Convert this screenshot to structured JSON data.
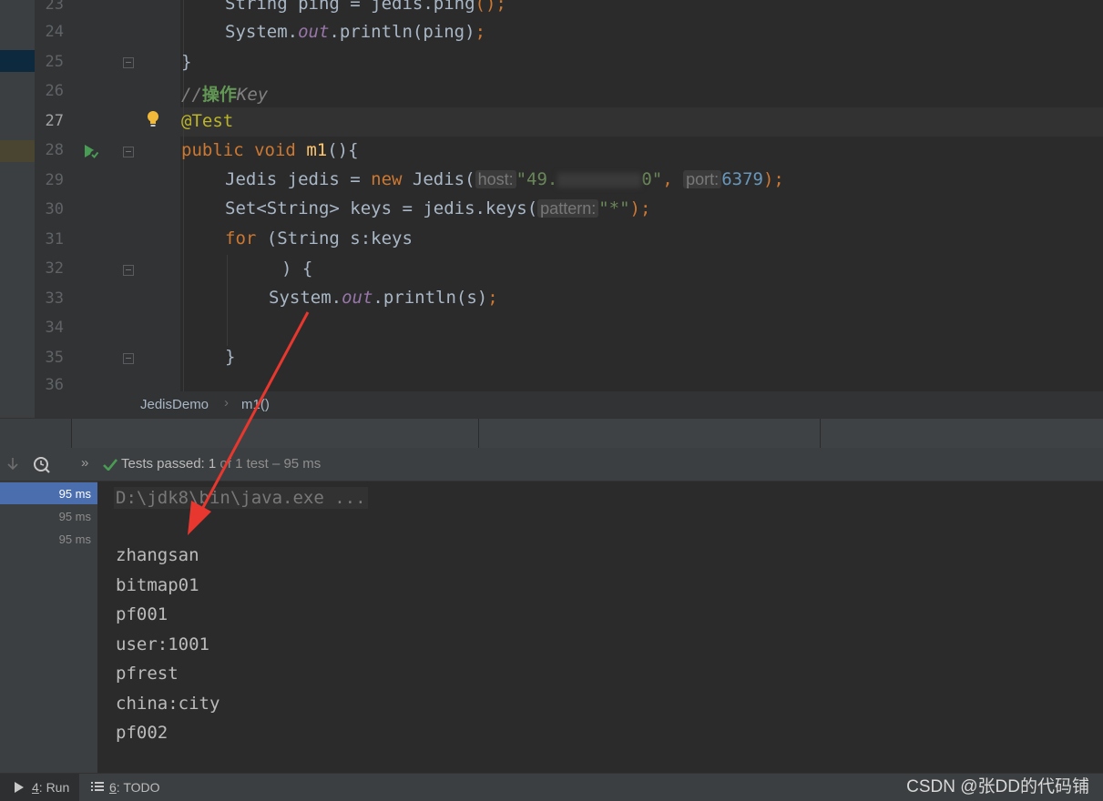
{
  "editor": {
    "line_numbers": [
      "23",
      "24",
      "25",
      "26",
      "27",
      "28",
      "29",
      "30",
      "31",
      "32",
      "33",
      "34",
      "35",
      "36"
    ],
    "code": {
      "l23_a": "String ping = jedis.ping",
      "l23_b": "();",
      "l24_a": "System.",
      "l24_out": "out",
      "l24_b": ".println(ping)",
      "l24_c": ";",
      "l25": "}",
      "l26_a": "//",
      "l26_b": "操作",
      "l26_c": "Key",
      "l27": "@Test",
      "l28_kw1": "public",
      "l28_kw2": "void",
      "l28_fn": "m1",
      "l28_rest": "(){",
      "l29_a": "Jedis jedis = ",
      "l29_new": "new",
      "l29_b": " Jedis(",
      "l29_hint_host": "host:",
      "l29_str_a": "\"49.",
      "l29_str_b": "0\"",
      "l29_comma": ",",
      "l29_hint_port": "port:",
      "l29_num": "6379",
      "l29_end": ");",
      "l30_a": "Set<String> keys = jedis.keys(",
      "l30_hint_pattern": "pattern:",
      "l30_str": "\"*\"",
      "l30_end": ");",
      "l31_kw": "for",
      "l31_b": " (String s:keys",
      "l32": ") {",
      "l33_a": "System.",
      "l33_out": "out",
      "l33_b": ".println(s)",
      "l33_c": ";",
      "l35": "}"
    }
  },
  "breadcrumb": {
    "class_name": "JedisDemo",
    "separator": "›",
    "method": "m1()"
  },
  "test_toolbar": {
    "status_label": "Tests passed:",
    "status_count": "1",
    "status_detail": "of 1 test – 95 ms",
    "expand_glyph": "»"
  },
  "test_tree": {
    "rows": [
      {
        "time": "95 ms",
        "selected": true
      },
      {
        "time": "95 ms",
        "selected": false
      },
      {
        "time": "95 ms",
        "selected": false
      }
    ]
  },
  "console": {
    "command": "D:\\jdk8\\bin\\java.exe ...",
    "output": [
      "zhangsan",
      "bitmap01",
      "pf001",
      "user:1001",
      "pfrest",
      "china:city",
      "pf002"
    ]
  },
  "bottom_bar": {
    "run_number": "4",
    "run_label": ": Run",
    "todo_number": "6",
    "todo_label": ": TODO",
    "watermark": "CSDN @张DD的代码铺"
  },
  "colors": {
    "accent_selection": "#4b6eaf",
    "pass_green": "#499c54",
    "annotation_arrow": "#e8372e"
  }
}
